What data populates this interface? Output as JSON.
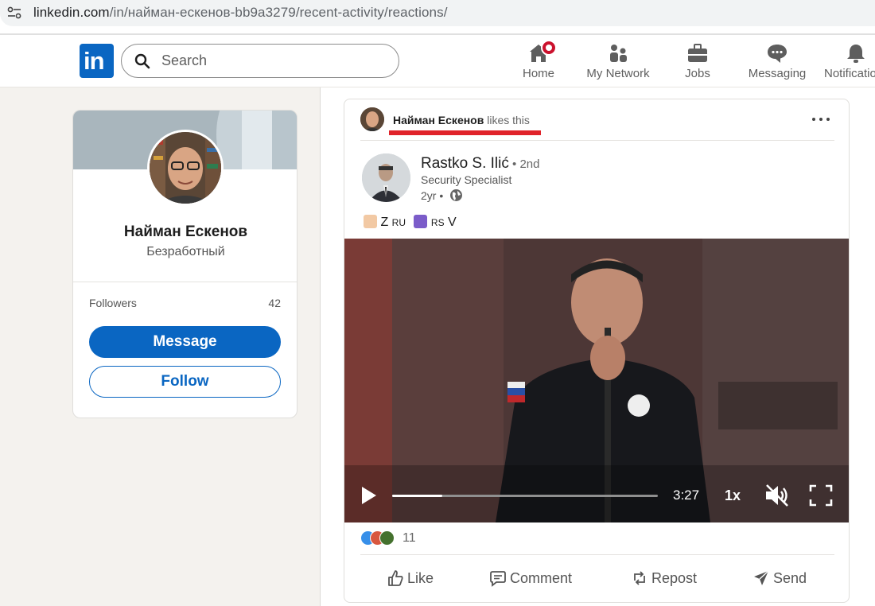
{
  "browser": {
    "url_prefix": "linkedin.com",
    "url_rest": "/in/найман-ескенов-bb9a3279/recent-activity/reactions/"
  },
  "header": {
    "logo": "in",
    "search_placeholder": "Search",
    "nav": [
      {
        "label": "Home",
        "icon": "home-icon",
        "badge": true
      },
      {
        "label": "My Network",
        "icon": "network-icon"
      },
      {
        "label": "Jobs",
        "icon": "briefcase-icon"
      },
      {
        "label": "Messaging",
        "icon": "chat-icon"
      },
      {
        "label": "Notifications",
        "icon": "bell-icon"
      }
    ],
    "colors": {
      "brand": "#0a66c2",
      "badge": "#cb112d"
    }
  },
  "profile": {
    "name": "Найман Ескенов",
    "headline": "Безработный",
    "followers_label": "Followers",
    "followers_count": "42",
    "message_label": "Message",
    "follow_label": "Follow"
  },
  "post": {
    "activity_name": "Найман Ескенов",
    "activity_verb": " likes this",
    "author_name": "Rastko S. Ilić",
    "author_degree": " • 2nd",
    "author_title": "Security Specialist",
    "time": "2yr •",
    "text_z": " Z ",
    "text_ru": "RU",
    "text_rs": "RS",
    "text_v": " V",
    "video": {
      "duration": "3:27",
      "speed": "1x",
      "progress": 0.19
    },
    "reaction_count": "11",
    "actions": [
      {
        "label": "Like",
        "icon": "like-icon"
      },
      {
        "label": "Comment",
        "icon": "comment-icon"
      },
      {
        "label": "Repost",
        "icon": "repost-icon"
      },
      {
        "label": "Send",
        "icon": "send-icon"
      }
    ]
  }
}
